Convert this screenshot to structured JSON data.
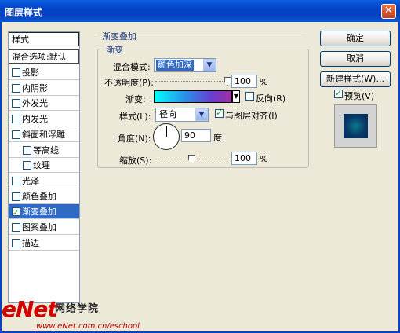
{
  "window": {
    "title": "图层样式",
    "close_glyph": "✕"
  },
  "sidebar": {
    "header": "样式",
    "blend_options": "混合选项:默认",
    "items": [
      {
        "label": "投影",
        "checked": false
      },
      {
        "label": "内阴影",
        "checked": false
      },
      {
        "label": "外发光",
        "checked": false
      },
      {
        "label": "内发光",
        "checked": false
      },
      {
        "label": "斜面和浮雕",
        "checked": false
      },
      {
        "label": "等高线",
        "checked": false
      },
      {
        "label": "纹理",
        "checked": false
      },
      {
        "label": "光泽",
        "checked": false
      },
      {
        "label": "颜色叠加",
        "checked": false
      },
      {
        "label": "渐变叠加",
        "checked": true,
        "selected": true
      },
      {
        "label": "图案叠加",
        "checked": false
      },
      {
        "label": "描边",
        "checked": false
      }
    ]
  },
  "panel": {
    "title": "渐变叠加",
    "group": "渐变",
    "blend_mode_label": "混合模式:",
    "blend_mode_value": "颜色加深",
    "opacity_label": "不透明度(P):",
    "opacity_value": "100",
    "opacity_unit": "%",
    "gradient_label": "渐变:",
    "reverse_label": "反向(R)",
    "style_label": "样式(L):",
    "style_value": "径向",
    "align_label": "与图层对齐(I)",
    "angle_label": "角度(N):",
    "angle_value": "90",
    "angle_unit": "度",
    "scale_label": "缩放(S):",
    "scale_value": "100",
    "scale_unit": "%",
    "opacity_level": 1.0,
    "scale_level": 0.5
  },
  "buttons": {
    "ok": "确定",
    "cancel": "取消",
    "new_style": "新建样式(W)...",
    "preview_label": "预览(V)"
  },
  "watermark": {
    "main": "eNet",
    "sub": "网络学院",
    "url": "www.eNet.com.cn/eschool"
  }
}
